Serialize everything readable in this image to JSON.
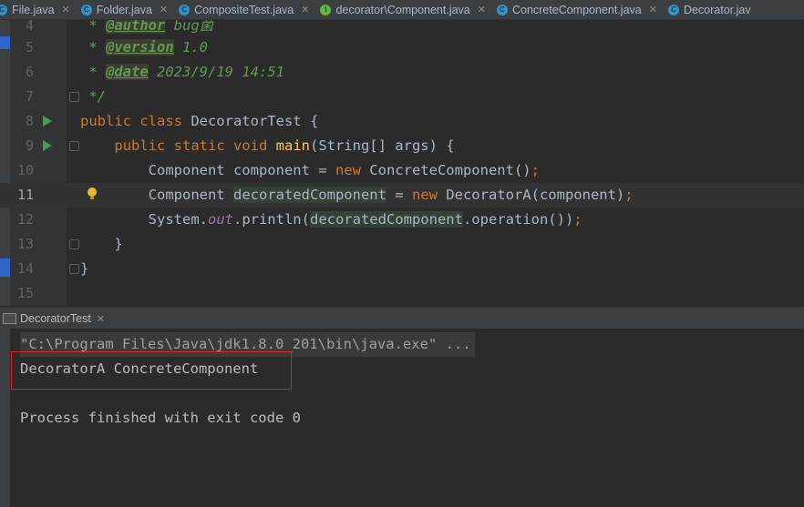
{
  "tabs": [
    {
      "label": "File.java",
      "icon": "class-icon",
      "color": "#3592c4"
    },
    {
      "label": "Folder.java",
      "icon": "class-icon",
      "color": "#3592c4"
    },
    {
      "label": "CompositeTest.java",
      "icon": "class-icon",
      "color": "#3592c4"
    },
    {
      "label": "decorator\\Component.java",
      "icon": "interface-icon",
      "color": "#62b543"
    },
    {
      "label": "ConcreteComponent.java",
      "icon": "class-icon",
      "color": "#3592c4"
    },
    {
      "label": "Decorator.jav",
      "icon": "abstract-class-icon",
      "color": "#3592c4"
    }
  ],
  "editor": {
    "line_numbers": [
      "4",
      "5",
      "6",
      "7",
      "8",
      "9",
      "10",
      "11",
      "12",
      "13",
      "14",
      "15"
    ],
    "current_line": "11",
    "code": {
      "l4_prefix": " * ",
      "l4_tag": "@author",
      "l4_rest": " bug菌",
      "l5_prefix": " * ",
      "l5_tag": "@version",
      "l5_rest": " 1.0",
      "l6_prefix": " * ",
      "l6_tag": "@date",
      "l6_rest": " 2023/9/19 14:51",
      "l7": " */",
      "l8_kw": "public class",
      "l8_rest": " DecoratorTest {",
      "l9_indent": "    ",
      "l9_kw": "public static void",
      "l9_sp": " ",
      "l9_fn": "main",
      "l9_rest": "(String[] args) {",
      "l10_a": "        Component component = ",
      "l10_kw": "new",
      "l10_b": " ConcreteComponent()",
      "l10_semi": ";",
      "l11_a": "        Component ",
      "l11_hl": "decoratedComponent",
      "l11_b": " = ",
      "l11_kw": "new",
      "l11_c": " DecoratorA(component)",
      "l11_semi": ";",
      "l12_a": "        System.",
      "l12_field": "out",
      "l12_b": ".println(",
      "l12_hl": "decoratedComponent",
      "l12_c": ".operation())",
      "l12_semi": ";",
      "l13": "    }",
      "l14": "}",
      "l15": ""
    }
  },
  "run_panel": {
    "tab_label": "DecoratorTest",
    "command": "\"C:\\Program Files\\Java\\jdk1.8.0_201\\bin\\java.exe\" ...",
    "output_line": "DecoratorA ConcreteComponent",
    "exit_line": "Process finished with exit code 0",
    "highlight_color": "#e0231f"
  }
}
